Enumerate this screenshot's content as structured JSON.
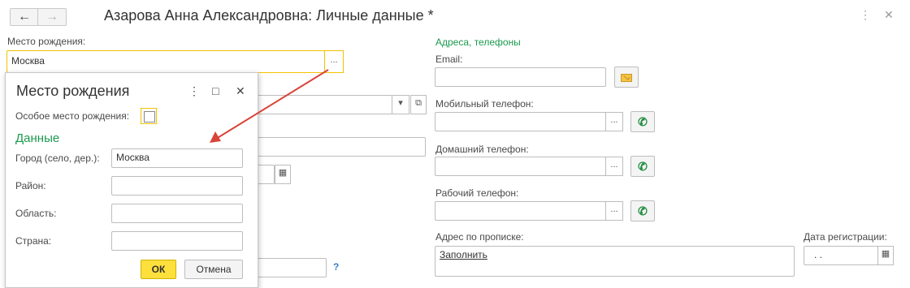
{
  "header": {
    "back_icon": "←",
    "forward_icon": "→",
    "title": "Азарова Анна Александровна: Личные данные *",
    "more_icon": "⋮",
    "close_icon": "✕"
  },
  "birthplace": {
    "label": "Место рождения:",
    "value": "Москва",
    "select_btn": "..."
  },
  "contacts": {
    "section_title": "Адреса, телефоны",
    "email_label": "Email:",
    "mobile_label": "Мобильный телефон:",
    "home_label": "Домашний телефон:",
    "work_label": "Рабочий телефон:",
    "select_btn": "...",
    "phone_icon": "✆",
    "address_label": "Адрес по прописке:",
    "address_link": "Заполнить",
    "reg_date_label": "Дата регистрации:",
    "reg_date_value": ".   .",
    "calendar_icon": "▦",
    "dropdown_icon": "▾",
    "open_icon": "⧉",
    "help_icon": "?"
  },
  "popup": {
    "title": "Место рождения",
    "more_icon": "⋮",
    "maximize_icon": "□",
    "close_icon": "✕",
    "special_label": "Особое место рождения:",
    "section_title": "Данные",
    "city_label": "Город (село, дер.):",
    "city_value": "Москва",
    "district_label": "Район:",
    "district_value": "",
    "region_label": "Область:",
    "region_value": "",
    "country_label": "Страна:",
    "country_value": "",
    "ok_label": "ОК",
    "cancel_label": "Отмена"
  },
  "colors": {
    "accent_yellow": "#f2c200",
    "section_green": "#1a9a4e",
    "arrow_red": "#d9443a"
  }
}
